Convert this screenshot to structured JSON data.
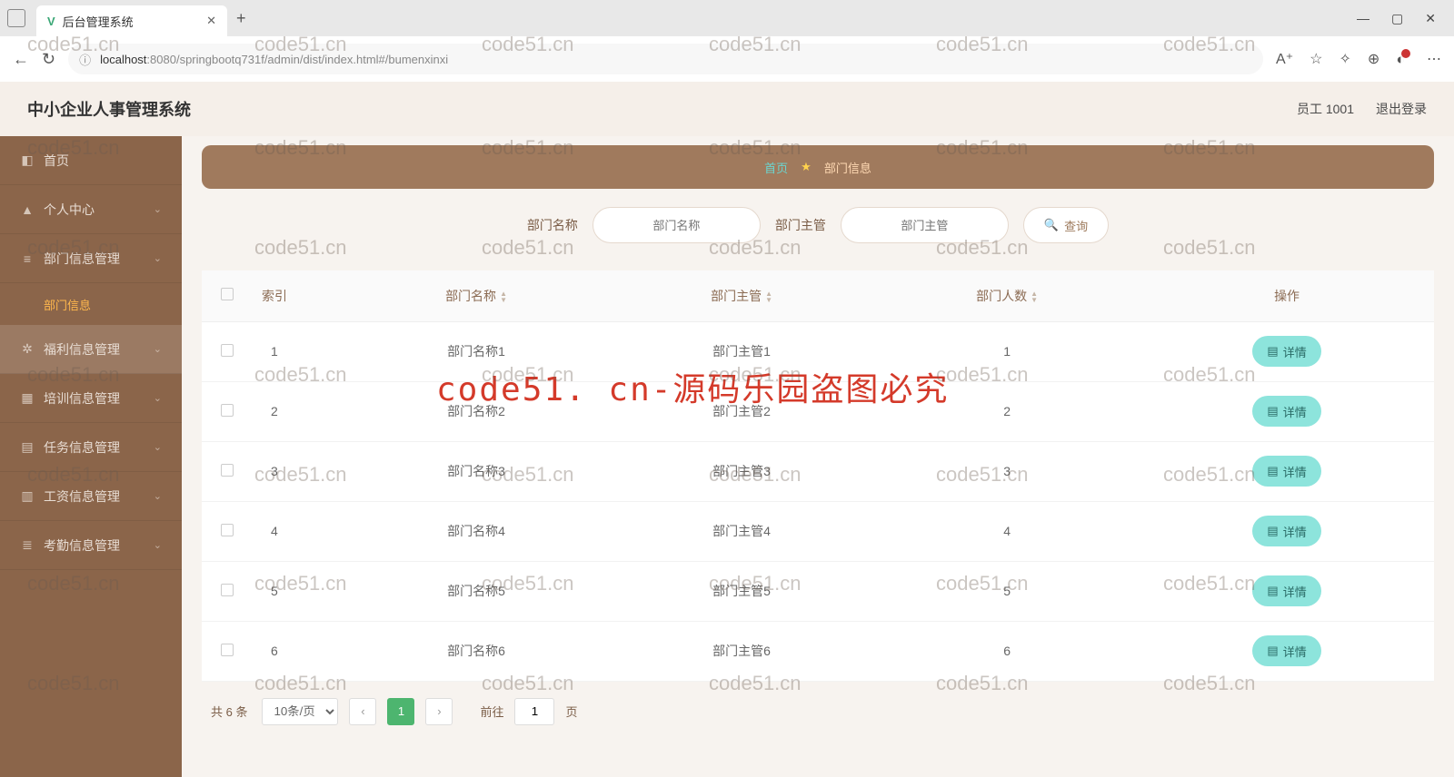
{
  "browser": {
    "tab_title": "后台管理系统",
    "url_host": "localhost",
    "url_port": ":8080",
    "url_path": "/springbootq731f/admin/dist/index.html#/bumenxinxi"
  },
  "header": {
    "app_title": "中小企业人事管理系统",
    "user_label": "员工 1001",
    "logout": "退出登录"
  },
  "sidebar": {
    "items": [
      {
        "icon": "◧",
        "label": "首页",
        "expandable": false
      },
      {
        "icon": "▲",
        "label": "个人中心",
        "expandable": true
      },
      {
        "icon": "≡",
        "label": "部门信息管理",
        "expandable": true,
        "children": [
          {
            "label": "部门信息",
            "active": true
          }
        ]
      },
      {
        "icon": "✲",
        "label": "福利信息管理",
        "expandable": true,
        "hover": true
      },
      {
        "icon": "▦",
        "label": "培训信息管理",
        "expandable": true
      },
      {
        "icon": "▤",
        "label": "任务信息管理",
        "expandable": true
      },
      {
        "icon": "▥",
        "label": "工资信息管理",
        "expandable": true
      },
      {
        "icon": "≣",
        "label": "考勤信息管理",
        "expandable": true
      }
    ]
  },
  "breadcrumb": {
    "home": "首页",
    "current": "部门信息"
  },
  "search": {
    "label1": "部门名称",
    "placeholder1": "部门名称",
    "label2": "部门主管",
    "placeholder2": "部门主管",
    "button": "查询"
  },
  "table": {
    "columns": {
      "index": "索引",
      "name": "部门名称",
      "manager": "部门主管",
      "count": "部门人数",
      "action": "操作"
    },
    "detail_label": "详情",
    "rows": [
      {
        "index": "1",
        "name": "部门名称1",
        "manager": "部门主管1",
        "count": "1"
      },
      {
        "index": "2",
        "name": "部门名称2",
        "manager": "部门主管2",
        "count": "2"
      },
      {
        "index": "3",
        "name": "部门名称3",
        "manager": "部门主管3",
        "count": "3"
      },
      {
        "index": "4",
        "name": "部门名称4",
        "manager": "部门主管4",
        "count": "4"
      },
      {
        "index": "5",
        "name": "部门名称5",
        "manager": "部门主管5",
        "count": "5"
      },
      {
        "index": "6",
        "name": "部门名称6",
        "manager": "部门主管6",
        "count": "6"
      }
    ]
  },
  "pagination": {
    "total_text": "共 6 条",
    "page_size": "10条/页",
    "current_page": "1",
    "jump_label": "前往",
    "jump_value": "1",
    "jump_suffix": "页"
  },
  "watermark": {
    "small": "code51.cn",
    "big": "code51. cn-源码乐园盗图必究"
  }
}
